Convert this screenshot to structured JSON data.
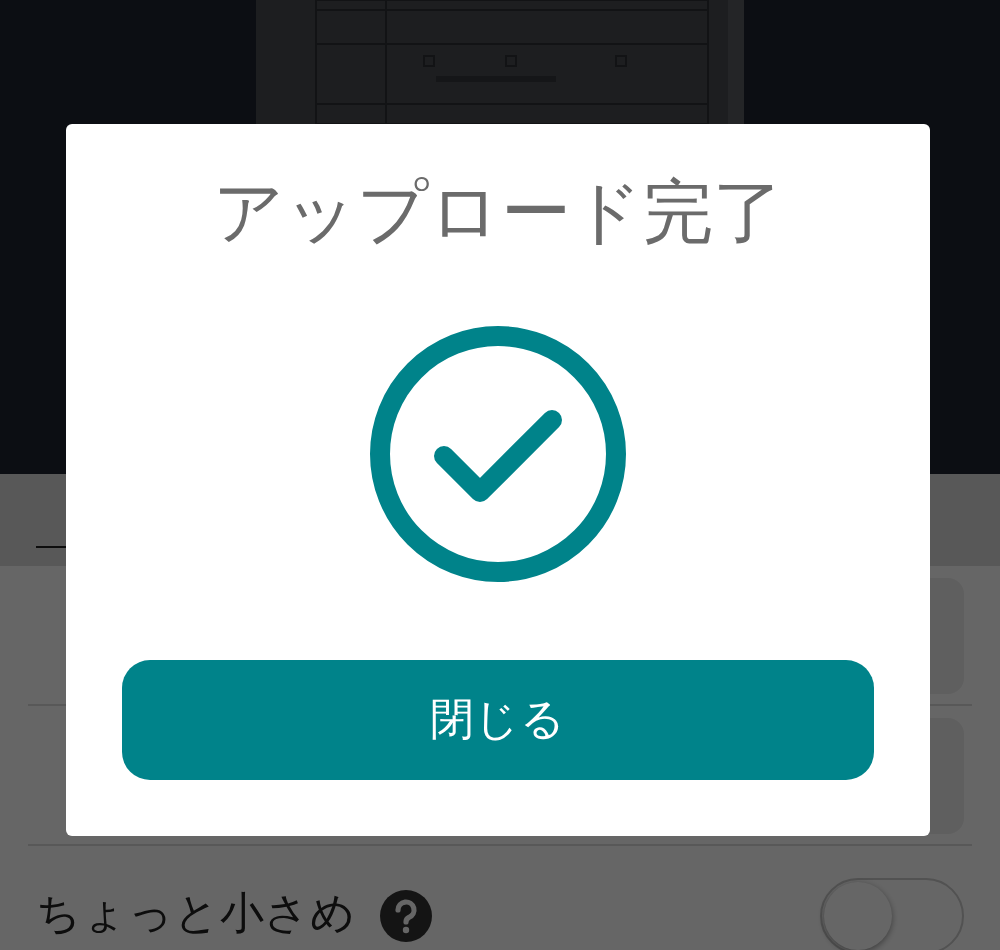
{
  "rows": [
    {
      "kind": "link"
    },
    {
      "kind": "field"
    },
    {
      "kind": "field"
    },
    {
      "kind": "toggle",
      "label": "ちょっと小さめ",
      "on": false
    }
  ],
  "modal": {
    "title": "アップロード完了",
    "button": "閉じる"
  }
}
